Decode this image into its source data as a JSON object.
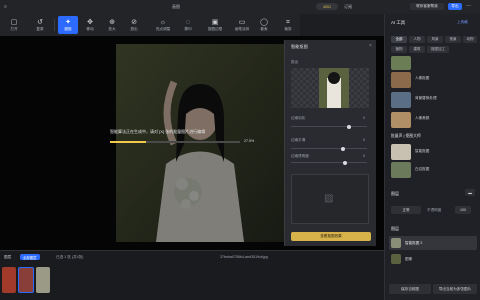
{
  "title_bar": {
    "title": "画图",
    "credits": "4001",
    "btn1": "订阅",
    "btn2": "联系客服帮我",
    "btn3": "导出"
  },
  "toolbar": {
    "items": [
      "打开",
      "复原",
      "魔抠",
      "移动",
      "放大",
      "退出",
      "亮点调整",
      "擦印",
      "抠图边框",
      "画笔涂抹",
      "套索",
      "裁剪"
    ]
  },
  "progress": {
    "message": "智能算法正在生成中，请对 [X] 张的批量图片进行编辑",
    "percent_label": "27.5%",
    "value": 0.275
  },
  "panel": {
    "title": "智能抠图",
    "sub": "抠出",
    "label1": "边缘羽化",
    "label2": "边缘平滑",
    "label3": "边缘透明度",
    "v1": "0",
    "v2": "0",
    "v3": "0",
    "apply": "查看抠图效果"
  },
  "right": {
    "header": "AI 工具",
    "link": "上传格",
    "tags": [
      "全部",
      "人物",
      "风景",
      "夜景",
      "动物",
      "植物",
      "建筑",
      "抠图加工"
    ],
    "items": [
      {
        "label": "人像抠图"
      },
      {
        "label": "背景替换处理"
      },
      {
        "label": "人像美颜"
      }
    ],
    "section": "批量声 | 抠图大师",
    "section_items": [
      {
        "label": "智能抠图"
      },
      {
        "label": "白边抠图"
      }
    ],
    "layers_title": "图层",
    "blend": "正常",
    "opacity_label": "不透明度",
    "opacity": "100",
    "layer_title": "图层",
    "layer1": "智能抠图 2",
    "layer2": "图像",
    "btn_left": "保存当前图",
    "btn_right": "导出当前为多张图片"
  },
  "bottom": {
    "tab1": "图层",
    "tab2": "全部图层",
    "count": "已选 1 张 (共4张)",
    "filename": "37beba0756b4-aed3519cbjpg"
  },
  "colors": {
    "accent": "#2d6bff",
    "progress": "#f2c94c",
    "apply": "#d7b14a"
  }
}
